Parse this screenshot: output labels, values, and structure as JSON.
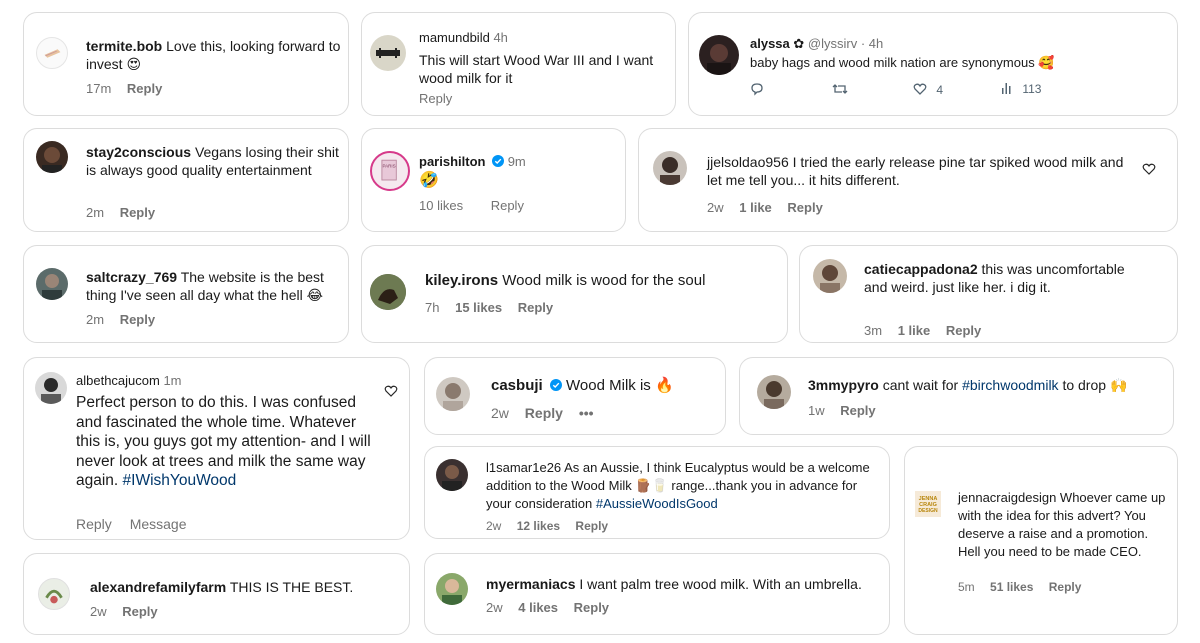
{
  "comments": [
    {
      "id": "c1",
      "user": "termite.bob",
      "text": "Love this, looking forward to invest",
      "emoji": "😍",
      "time": "17m",
      "reply": "Reply"
    },
    {
      "id": "c2",
      "user": "mamundbild",
      "time": "4h",
      "text": "This will start Wood War III and I want wood milk for it",
      "reply": "Reply"
    },
    {
      "id": "c3",
      "user": "alyssa ✿",
      "handle": "@lyssirv · 4h",
      "text": "baby hags and wood milk nation are synonymous",
      "emoji": "🥰",
      "likes": "4",
      "views": "113"
    },
    {
      "id": "c4",
      "user": "stay2conscious",
      "text": "Vegans losing their shit is always good quality entertainment",
      "time": "2m",
      "reply": "Reply"
    },
    {
      "id": "c5",
      "user": "parishilton",
      "time": "9m",
      "emoji": "🤣",
      "likes": "10 likes",
      "reply": "Reply"
    },
    {
      "id": "c6",
      "user": "jjelsoldao956",
      "text": "I tried the early release pine tar spiked wood milk and let me tell you... it hits different.",
      "time": "2w",
      "likes": "1 like",
      "reply": "Reply"
    },
    {
      "id": "c7",
      "user": "saltcrazy_769",
      "text": "The website is the best thing I've seen all day what the hell",
      "emoji": "😂",
      "time": "2m",
      "reply": "Reply"
    },
    {
      "id": "c8",
      "user": "kiley.irons",
      "text": "Wood milk is wood for the soul",
      "time": "7h",
      "likes": "15 likes",
      "reply": "Reply"
    },
    {
      "id": "c9",
      "user": "catiecappadona2",
      "text": "this was uncomfortable and weird. just like her. i dig it.",
      "time": "3m",
      "likes": "1 like",
      "reply": "Reply"
    },
    {
      "id": "c10",
      "user": "albethcajucom",
      "time": "1m",
      "text": "Perfect person to do this. I was confused and fascinated the whole time. Whatever this is, you guys got my attention- and I will never look at trees and milk the same way again.",
      "hashtag": "#IWishYouWood",
      "reply": "Reply",
      "message": "Message"
    },
    {
      "id": "c11",
      "user": "casbuji",
      "text": "Wood Milk is",
      "emoji": "🔥",
      "time": "2w",
      "reply": "Reply",
      "more": "•••"
    },
    {
      "id": "c12",
      "user": "3mmypyro",
      "text": "cant wait for",
      "hashtag": "#birchwoodmilk",
      "text2": "to drop",
      "emoji": "🙌",
      "time": "1w",
      "reply": "Reply"
    },
    {
      "id": "c13",
      "user": "l1samar1e26",
      "text": "As an Aussie, I think Eucalyptus would be a welcome addition to the Wood Milk",
      "emoji": "🪵🥛",
      "text2": "range...thank you in advance for your consideration",
      "hashtag": "#AussieWoodIsGood",
      "time": "2w",
      "likes": "12 likes",
      "reply": "Reply"
    },
    {
      "id": "c14",
      "user": "jennacraigdesign",
      "text": "Whoever came up with the idea for this advert? You deserve a raise and a promotion. Hell you need to be made CEO.",
      "time": "5m",
      "likes": "51 likes",
      "reply": "Reply"
    },
    {
      "id": "c15",
      "user": "alexandrefamilyfarm",
      "text": "THIS IS THE BEST.",
      "time": "2w",
      "reply": "Reply"
    },
    {
      "id": "c16",
      "user": "myermaniacs",
      "text": "I want palm tree wood milk. With an umbrella.",
      "time": "2w",
      "likes": "4 likes",
      "reply": "Reply"
    }
  ],
  "colors": {
    "border": "#dcdcdc",
    "muted": "#737373",
    "hashtag": "#00376b",
    "verified": "#0095f6"
  },
  "icons": [
    "heart-icon",
    "verified-icon",
    "reply-icon",
    "retweet-icon",
    "views-icon",
    "more-icon"
  ],
  "avatar_logo_text": {
    "jenna": "JENNA CRAIG DESIGN",
    "pamph": "PARIS"
  }
}
